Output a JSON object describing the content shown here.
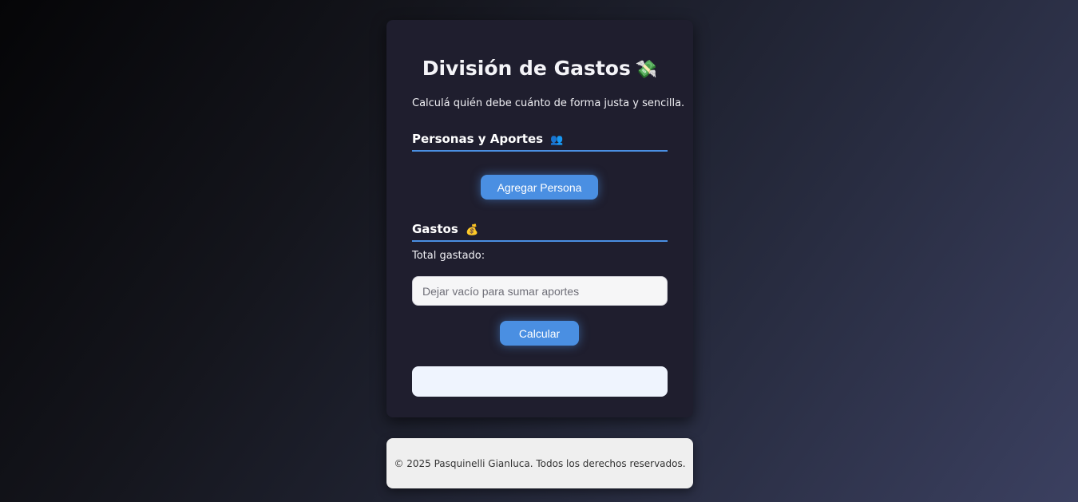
{
  "app": {
    "title": "División de Gastos",
    "title_icon": "💸",
    "subtitle": "Calculá quién debe cuánto de forma justa y sencilla."
  },
  "people_section": {
    "heading": "Personas y Aportes",
    "icon": "👥",
    "add_button_label": "Agregar Persona"
  },
  "expenses_section": {
    "heading": "Gastos",
    "icon": "💰",
    "total_label": "Total gastado:",
    "total_input": {
      "value": "",
      "placeholder": "Dejar vacío para sumar aportes"
    },
    "calculate_button_label": "Calcular"
  },
  "result": {
    "text": ""
  },
  "footer": {
    "text": "© 2025 Pasquinelli Gianluca. Todos los derechos reservados."
  },
  "colors": {
    "accent": "#4a8fe2",
    "card_background": "#1f1e2e",
    "result_background": "#eff4fe",
    "footer_background": "#efefef"
  }
}
